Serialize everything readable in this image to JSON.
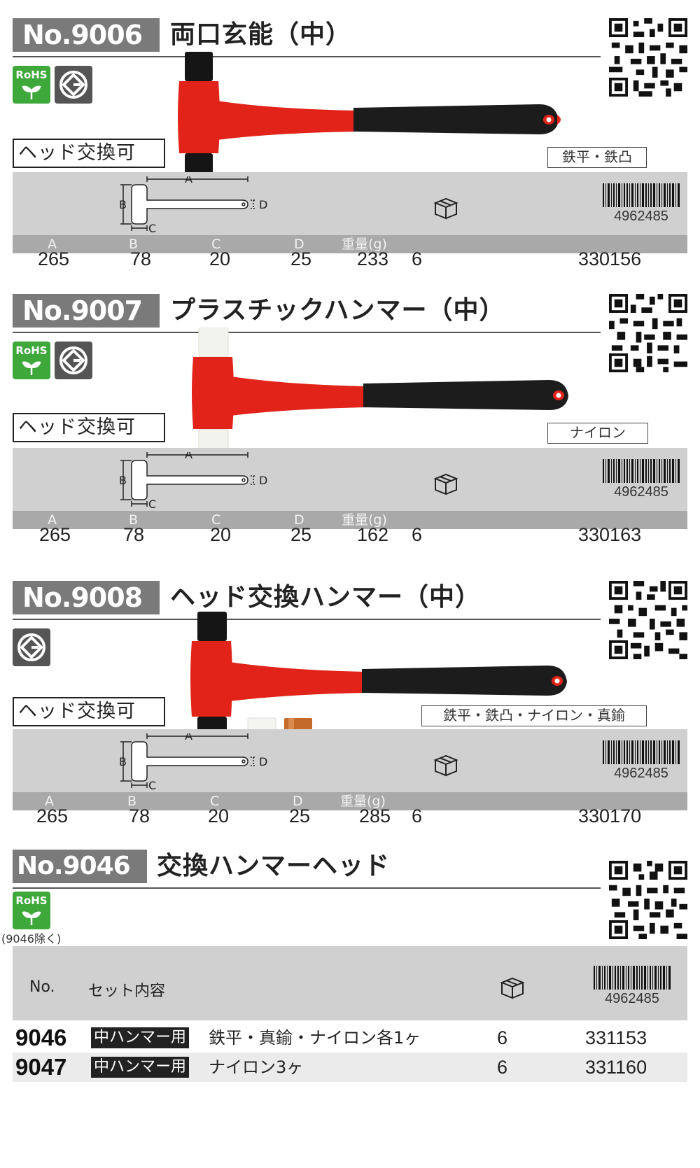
{
  "products": [
    {
      "number": "No.9006",
      "title": "両口玄能（中）",
      "rohs": true,
      "rohs_label": "RoHS",
      "head_label": "ヘッド交換可",
      "head_material": "鉄平・鉄凸",
      "head_color": "#1a1a1a",
      "dim_labels": {
        "a": "A",
        "b": "B",
        "c": "C",
        "d": "D"
      },
      "spec_headers": [
        "A",
        "B",
        "C",
        "D",
        "重量(g)"
      ],
      "barcode_prefix": "4962485",
      "values": {
        "a": "265",
        "b": "78",
        "c": "20",
        "d": "25",
        "weight": "233",
        "pack": "6",
        "code": "330156"
      }
    },
    {
      "number": "No.9007",
      "title": "プラスチックハンマー（中）",
      "rohs": true,
      "rohs_label": "RoHS",
      "head_label": "ヘッド交換可",
      "head_material": "ナイロン",
      "head_color": "#f3f3ee",
      "dim_labels": {
        "a": "A",
        "b": "B",
        "c": "C",
        "d": "D"
      },
      "spec_headers": [
        "A",
        "B",
        "C",
        "D",
        "重量(g)"
      ],
      "barcode_prefix": "4962485",
      "values": {
        "a": "265",
        "b": "78",
        "c": "20",
        "d": "25",
        "weight": "162",
        "pack": "6",
        "code": "330163"
      }
    },
    {
      "number": "No.9008",
      "title": "ヘッド交換ハンマー（中）",
      "rohs": false,
      "head_label": "ヘッド交換可",
      "head_material": "鉄平・鉄凸・ナイロン・真鍮",
      "head_color": "#1a1a1a",
      "dim_labels": {
        "a": "A",
        "b": "B",
        "c": "C",
        "d": "D"
      },
      "spec_headers": [
        "A",
        "B",
        "C",
        "D",
        "重量(g)"
      ],
      "barcode_prefix": "4962485",
      "values": {
        "a": "265",
        "b": "78",
        "c": "20",
        "d": "25",
        "weight": "285",
        "pack": "6",
        "code": "330170"
      }
    }
  ],
  "replacement": {
    "number": "No.9046～",
    "title": "交換ハンマーヘッド",
    "rohs_label": "RoHS",
    "rohs_note": "(9046除く)",
    "headers": {
      "no": "No.",
      "contents": "セット内容"
    },
    "barcode_prefix": "4962485",
    "rows": [
      {
        "no": "9046",
        "tag": "中ハンマー用",
        "desc": "鉄平・真鍮・ナイロン各1ヶ",
        "qty": "6",
        "code": "331153"
      },
      {
        "no": "9047",
        "tag": "中ハンマー用",
        "desc": "ナイロン3ヶ",
        "qty": "6",
        "code": "331160"
      }
    ]
  },
  "colors": {
    "hammer_red": "#e2231a",
    "grip_black": "#1c1c1c",
    "rohs_green": "#3ea83a",
    "panel_gray": "#d0d0d0",
    "header_gray": "#a9a9a9",
    "title_gray": "#7a7a7a"
  }
}
